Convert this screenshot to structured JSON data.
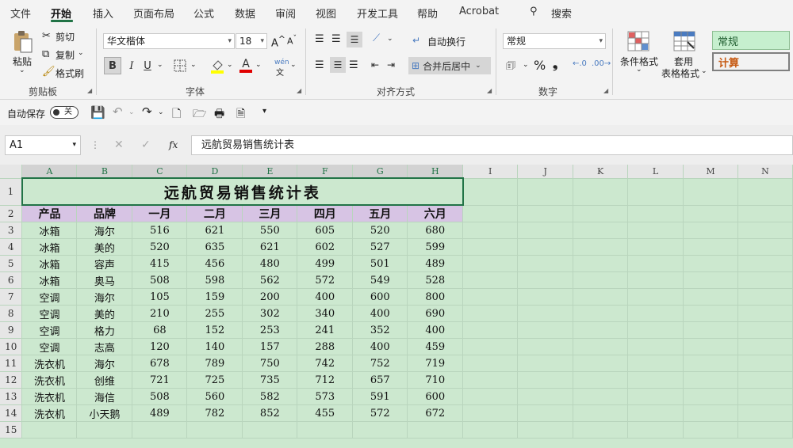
{
  "menu": {
    "items": [
      "文件",
      "开始",
      "插入",
      "页面布局",
      "公式",
      "数据",
      "审阅",
      "视图",
      "开发工具",
      "帮助",
      "Acrobat"
    ],
    "search_label": "搜索"
  },
  "ribbon": {
    "clipboard": {
      "paste": "粘贴",
      "cut": "剪切",
      "copy": "复制",
      "format_painter": "格式刷",
      "label": "剪贴板"
    },
    "font": {
      "name": "华文楷体",
      "size": "18",
      "label": "字体",
      "bold": "B",
      "italic": "I",
      "underline": "U",
      "grow": "A",
      "shrink": "A",
      "font_color_letter": "A",
      "wen": "文"
    },
    "alignment": {
      "wrap": "自动换行",
      "merge": "合并后居中",
      "label": "对齐方式"
    },
    "number": {
      "format": "常规",
      "label": "数字",
      "percent": "%",
      "comma": "❟"
    },
    "styles": {
      "conditional": "条件格式",
      "table_format_1": "套用",
      "table_format_2": "表格格式",
      "style_normal": "常规",
      "style_calc": "计算"
    }
  },
  "qat": {
    "autosave": "自动保存",
    "toggle_state": "关"
  },
  "formula_bar": {
    "name_box": "A1",
    "fx": "fx",
    "content": "远航贸易销售统计表"
  },
  "colors": {
    "accent": "#217346",
    "sheet_bg": "#cce8cf",
    "header_fill": "#d7c4e4",
    "style_normal_bg": "#c6efce",
    "style_calc_text": "#c65911"
  },
  "sheet": {
    "columns": [
      "A",
      "B",
      "C",
      "D",
      "E",
      "F",
      "G",
      "H",
      "I",
      "J",
      "K",
      "L",
      "M",
      "N"
    ],
    "rows": [
      "1",
      "2",
      "3",
      "4",
      "5",
      "6",
      "7",
      "8",
      "9",
      "10",
      "11",
      "12",
      "13",
      "14",
      "15"
    ],
    "title": "远航贸易销售统计表",
    "headers": [
      "产品",
      "品牌",
      "一月",
      "二月",
      "三月",
      "四月",
      "五月",
      "六月"
    ],
    "data": [
      [
        "冰箱",
        "海尔",
        "516",
        "621",
        "550",
        "605",
        "520",
        "680"
      ],
      [
        "冰箱",
        "美的",
        "520",
        "635",
        "621",
        "602",
        "527",
        "599"
      ],
      [
        "冰箱",
        "容声",
        "415",
        "456",
        "480",
        "499",
        "501",
        "489"
      ],
      [
        "冰箱",
        "奥马",
        "508",
        "598",
        "562",
        "572",
        "549",
        "528"
      ],
      [
        "空调",
        "海尔",
        "105",
        "159",
        "200",
        "400",
        "600",
        "800"
      ],
      [
        "空调",
        "美的",
        "210",
        "255",
        "302",
        "340",
        "400",
        "690"
      ],
      [
        "空调",
        "格力",
        "68",
        "152",
        "253",
        "241",
        "352",
        "400"
      ],
      [
        "空调",
        "志高",
        "120",
        "140",
        "157",
        "288",
        "400",
        "459"
      ],
      [
        "洗衣机",
        "海尔",
        "678",
        "789",
        "750",
        "742",
        "752",
        "719"
      ],
      [
        "洗衣机",
        "创维",
        "721",
        "725",
        "735",
        "712",
        "657",
        "710"
      ],
      [
        "洗衣机",
        "海信",
        "508",
        "560",
        "582",
        "573",
        "591",
        "600"
      ],
      [
        "洗衣机",
        "小天鹅",
        "489",
        "782",
        "852",
        "455",
        "572",
        "672"
      ]
    ]
  }
}
